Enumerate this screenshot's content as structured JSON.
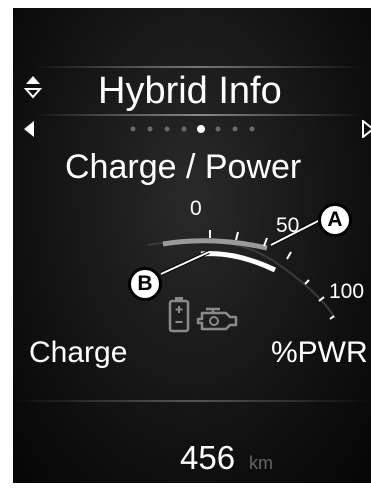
{
  "header": {
    "title": "Hybrid Info"
  },
  "subtitle": "Charge / Power",
  "pager": {
    "total": 8,
    "active_index": 5
  },
  "gauge": {
    "ticks": [
      "0",
      "50",
      "100"
    ],
    "left_label": "Charge",
    "right_label": "%PWR"
  },
  "callouts": {
    "a": "A",
    "b": "B"
  },
  "range": {
    "value": "456",
    "unit": "km"
  },
  "icons": {
    "scroll": "up-down-arrows-icon",
    "prev": "left-arrow-icon",
    "next": "right-arrow-icon",
    "battery": "battery-icon",
    "engine": "engine-icon"
  }
}
